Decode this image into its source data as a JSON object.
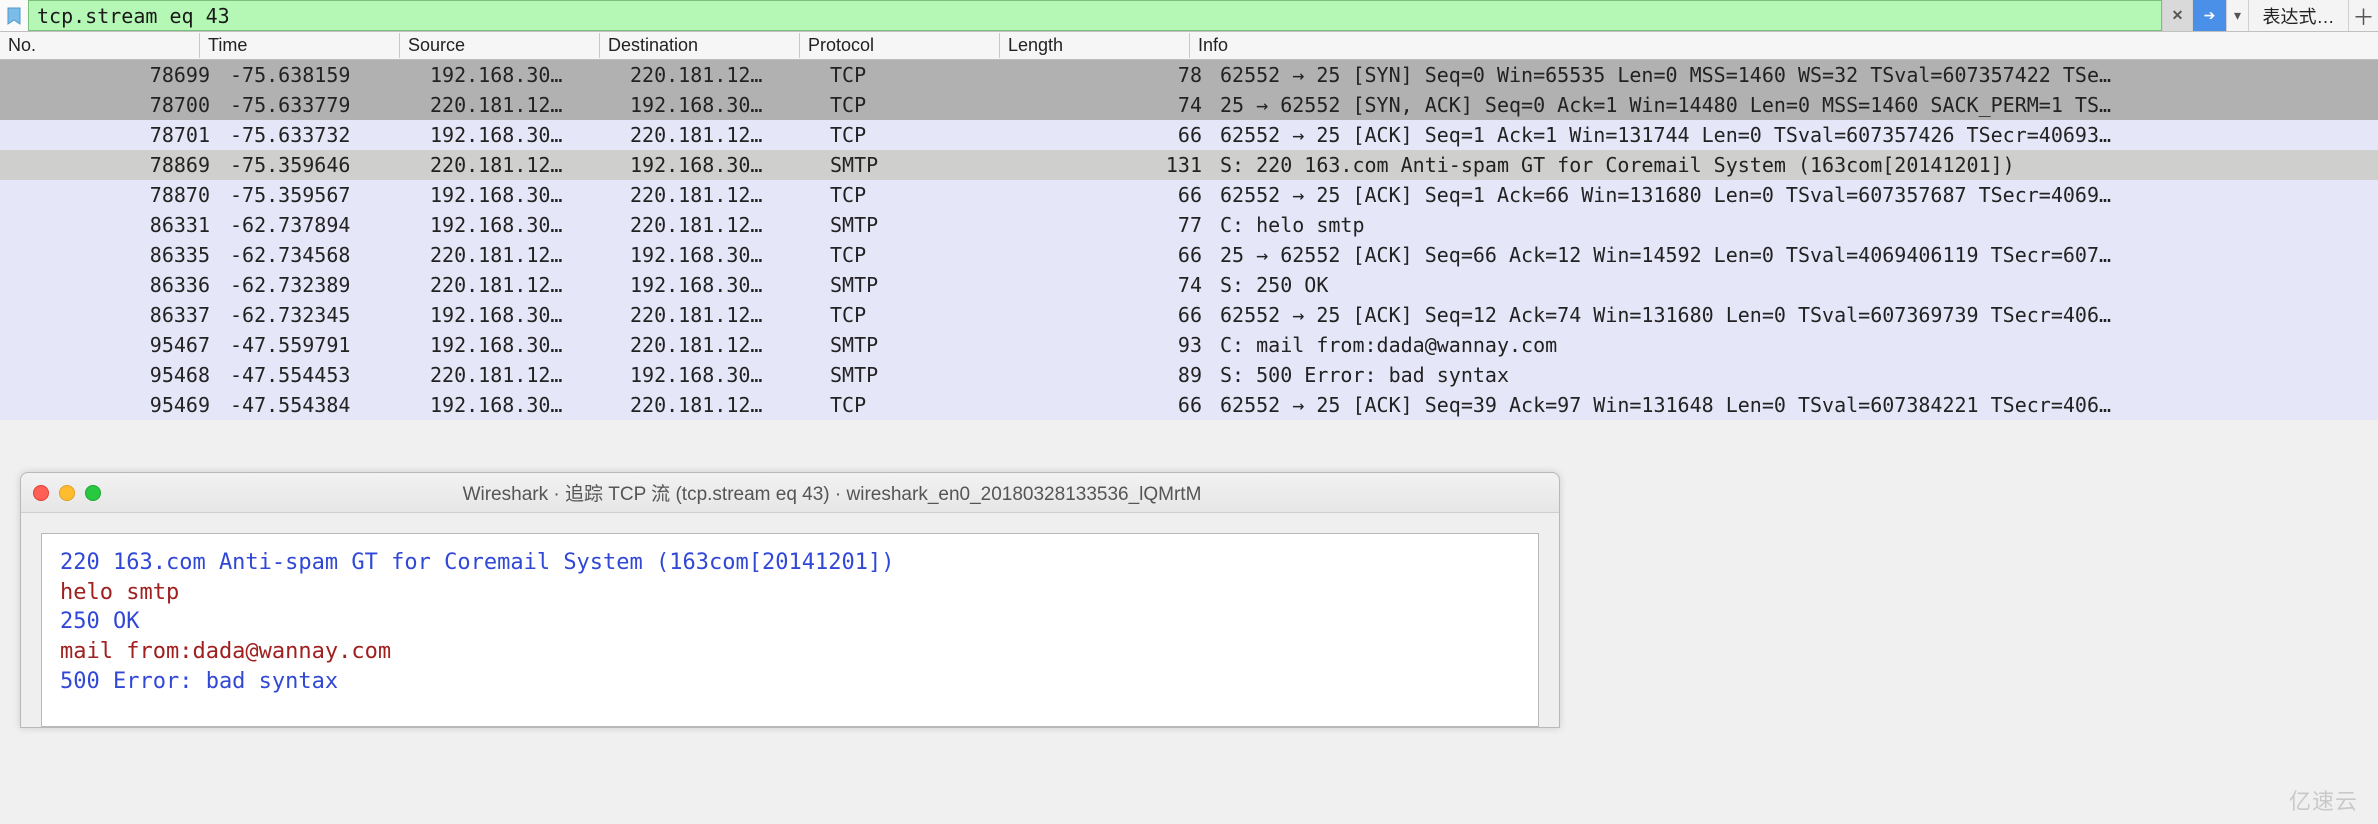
{
  "filter": {
    "value": "tcp.stream eq 43",
    "expr_button": "表达式…",
    "clear_label": "✕",
    "arrow_label": "➔",
    "dd_label": "▾",
    "plus_label": "＋"
  },
  "columns": {
    "no": "No.",
    "time": "Time",
    "source": "Source",
    "destination": "Destination",
    "protocol": "Protocol",
    "length": "Length",
    "info": "Info"
  },
  "packets": [
    {
      "no": "78699",
      "time": "-75.638159",
      "src": "192.168.30…",
      "dst": "220.181.12…",
      "proto": "TCP",
      "len": "78",
      "info": "62552 → 25 [SYN] Seq=0 Win=65535 Len=0 MSS=1460 WS=32 TSval=607357422 TSe…",
      "cls": "gray",
      "br": "top"
    },
    {
      "no": "78700",
      "time": "-75.633779",
      "src": "220.181.12…",
      "dst": "192.168.30…",
      "proto": "TCP",
      "len": "74",
      "info": "25 → 62552 [SYN, ACK] Seq=0 Ack=1 Win=14480 Len=0 MSS=1460 SACK_PERM=1 TS…",
      "cls": "gray",
      "br": "mid"
    },
    {
      "no": "78701",
      "time": "-75.633732",
      "src": "192.168.30…",
      "dst": "220.181.12…",
      "proto": "TCP",
      "len": "66",
      "info": "62552 → 25 [ACK] Seq=1 Ack=1 Win=131744 Len=0 TSval=607357426 TSecr=40693…",
      "cls": "lavender",
      "br": "bot"
    },
    {
      "no": "78869",
      "time": "-75.359646",
      "src": "220.181.12…",
      "dst": "192.168.30…",
      "proto": "SMTP",
      "len": "131",
      "info": "S: 220 163.com Anti-spam GT for Coremail System (163com[20141201])",
      "cls": "lavender-sel",
      "br": ""
    },
    {
      "no": "78870",
      "time": "-75.359567",
      "src": "192.168.30…",
      "dst": "220.181.12…",
      "proto": "TCP",
      "len": "66",
      "info": "62552 → 25 [ACK] Seq=1 Ack=66 Win=131680 Len=0 TSval=607357687 TSecr=4069…",
      "cls": "lavender",
      "br": ""
    },
    {
      "no": "86331",
      "time": "-62.737894",
      "src": "192.168.30…",
      "dst": "220.181.12…",
      "proto": "SMTP",
      "len": "77",
      "info": "C: helo smtp",
      "cls": "lavender",
      "br": ""
    },
    {
      "no": "86335",
      "time": "-62.734568",
      "src": "220.181.12…",
      "dst": "192.168.30…",
      "proto": "TCP",
      "len": "66",
      "info": "25 → 62552 [ACK] Seq=66 Ack=12 Win=14592 Len=0 TSval=4069406119 TSecr=607…",
      "cls": "lavender",
      "br": ""
    },
    {
      "no": "86336",
      "time": "-62.732389",
      "src": "220.181.12…",
      "dst": "192.168.30…",
      "proto": "SMTP",
      "len": "74",
      "info": "S: 250 OK",
      "cls": "lavender",
      "br": ""
    },
    {
      "no": "86337",
      "time": "-62.732345",
      "src": "192.168.30…",
      "dst": "220.181.12…",
      "proto": "TCP",
      "len": "66",
      "info": "62552 → 25 [ACK] Seq=12 Ack=74 Win=131680 Len=0 TSval=607369739 TSecr=406…",
      "cls": "lavender",
      "br": ""
    },
    {
      "no": "95467",
      "time": "-47.559791",
      "src": "192.168.30…",
      "dst": "220.181.12…",
      "proto": "SMTP",
      "len": "93",
      "info": "C: mail from:dada@wannay.com",
      "cls": "lavender",
      "br": ""
    },
    {
      "no": "95468",
      "time": "-47.554453",
      "src": "220.181.12…",
      "dst": "192.168.30…",
      "proto": "SMTP",
      "len": "89",
      "info": "S: 500 Error: bad syntax",
      "cls": "lavender",
      "br": ""
    },
    {
      "no": "95469",
      "time": "-47.554384",
      "src": "192.168.30…",
      "dst": "220.181.12…",
      "proto": "TCP",
      "len": "66",
      "info": "62552 → 25 [ACK] Seq=39 Ack=97 Win=131648 Len=0 TSval=607384221 TSecr=406…",
      "cls": "lavender",
      "br": ""
    }
  ],
  "follow": {
    "title": "Wireshark · 追踪 TCP 流 (tcp.stream eq 43) · wireshark_en0_20180328133536_lQMrtM",
    "lines": [
      {
        "txt": "220 163.com Anti-spam GT for Coremail System (163com[20141201])",
        "dir": "srv"
      },
      {
        "txt": "helo smtp",
        "dir": "cli"
      },
      {
        "txt": "250 OK",
        "dir": "srv"
      },
      {
        "txt": "mail from:dada@wannay.com",
        "dir": "cli"
      },
      {
        "txt": "500 Error: bad syntax",
        "dir": "srv"
      }
    ]
  },
  "watermark": "亿速云"
}
